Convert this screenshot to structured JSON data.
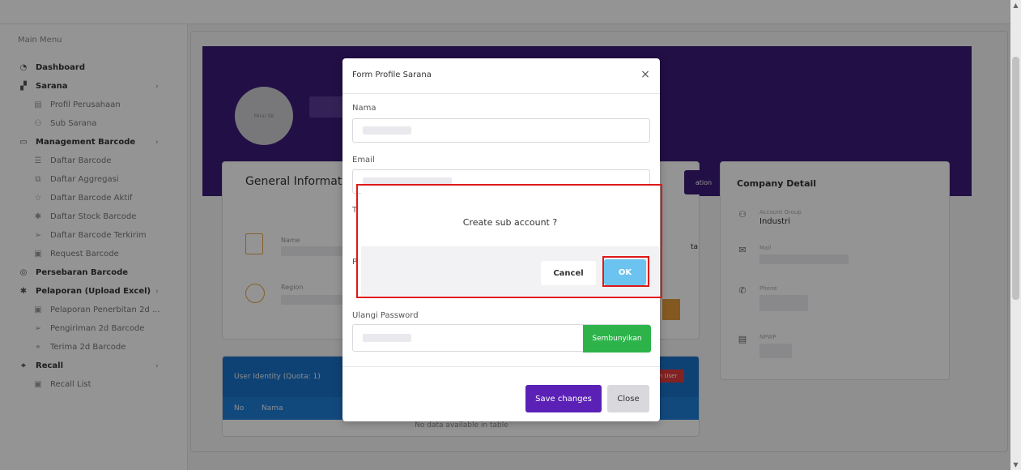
{
  "sidebar": {
    "title": "Main Menu",
    "items": [
      {
        "label": "Dashboard",
        "type": "parent",
        "icon": "dashboard-icon",
        "glyph": "◔",
        "chevron": ""
      },
      {
        "label": "Sarana",
        "type": "parent",
        "icon": "building-icon",
        "glyph": "▞",
        "chevron": "›"
      },
      {
        "label": "Profil Perusahaan",
        "type": "child",
        "icon": "company-icon",
        "glyph": "▤",
        "chevron": ""
      },
      {
        "label": "Sub Sarana",
        "type": "child",
        "icon": "users-icon",
        "glyph": "⚇",
        "chevron": ""
      },
      {
        "label": "Management Barcode",
        "type": "parent",
        "icon": "calendar-icon",
        "glyph": "▭",
        "chevron": "›"
      },
      {
        "label": "Daftar Barcode",
        "type": "child",
        "icon": "list-icon",
        "glyph": "☰",
        "chevron": ""
      },
      {
        "label": "Daftar Aggregasi",
        "type": "child",
        "icon": "layers-icon",
        "glyph": "⧉",
        "chevron": ""
      },
      {
        "label": "Daftar Barcode Aktif",
        "type": "child",
        "icon": "star-icon",
        "glyph": "☆",
        "chevron": ""
      },
      {
        "label": "Daftar Stock Barcode",
        "type": "child",
        "icon": "gear-icon",
        "glyph": "✱",
        "chevron": ""
      },
      {
        "label": "Daftar Barcode Terkirim",
        "type": "child",
        "icon": "send-icon",
        "glyph": "➢",
        "chevron": ""
      },
      {
        "label": "Request Barcode",
        "type": "child",
        "icon": "monitor-icon",
        "glyph": "▣",
        "chevron": ""
      },
      {
        "label": "Persebaran Barcode",
        "type": "parent",
        "icon": "map-pin-icon",
        "glyph": "◎",
        "chevron": ""
      },
      {
        "label": "Pelaporan (Upload Excel)",
        "type": "parent",
        "icon": "gear-icon",
        "glyph": "✱",
        "chevron": "›"
      },
      {
        "label": "Pelaporan Penerbitan 2d ...",
        "type": "child",
        "icon": "monitor-icon",
        "glyph": "▣",
        "chevron": ""
      },
      {
        "label": "Pengiriman 2d Barcode",
        "type": "child",
        "icon": "send-icon",
        "glyph": "➢",
        "chevron": ""
      },
      {
        "label": "Terima 2d Barcode",
        "type": "child",
        "icon": "receive-icon",
        "glyph": "⌖",
        "chevron": ""
      },
      {
        "label": "Recall",
        "type": "parent",
        "icon": "recall-icon",
        "glyph": "⌖",
        "chevron": "›"
      },
      {
        "label": "Recall List",
        "type": "child",
        "icon": "monitor-icon",
        "glyph": "▣",
        "chevron": ""
      }
    ]
  },
  "profile": {
    "avatar_text": "Mirai SB",
    "general_title": "General Information",
    "general_button": "ation",
    "name_label": "Name",
    "region_label": "Region",
    "side_text": "ta"
  },
  "company": {
    "title": "Company Detail",
    "account_group_label": "Account Group",
    "account_group_value": "Industri",
    "mail_label": "Mail",
    "phone_label": "Phone",
    "npwp_label": "NPWP"
  },
  "users": {
    "title": "User Identity (Quota: 1)",
    "add_button": "h User",
    "col_no": "No",
    "col_nama": "Nama",
    "empty": "No data available in table"
  },
  "modal": {
    "title": "Form Profile Sarana",
    "close_glyph": "×",
    "nama_label": "Nama",
    "email_label": "Email",
    "ulangi_password_label": "Ulangi Password",
    "show_button": "Sembunyikan",
    "partial_t": "T",
    "partial_p": "P",
    "save_button": "Save changes",
    "close_button": "Close"
  },
  "confirm": {
    "message": "Create sub account ?",
    "cancel": "Cancel",
    "ok": "OK"
  },
  "colors": {
    "hero": "#3b1a78",
    "save": "#5b21b6",
    "ok": "#6dc3ef",
    "show": "#2db34a",
    "highlight": "#e01818"
  }
}
